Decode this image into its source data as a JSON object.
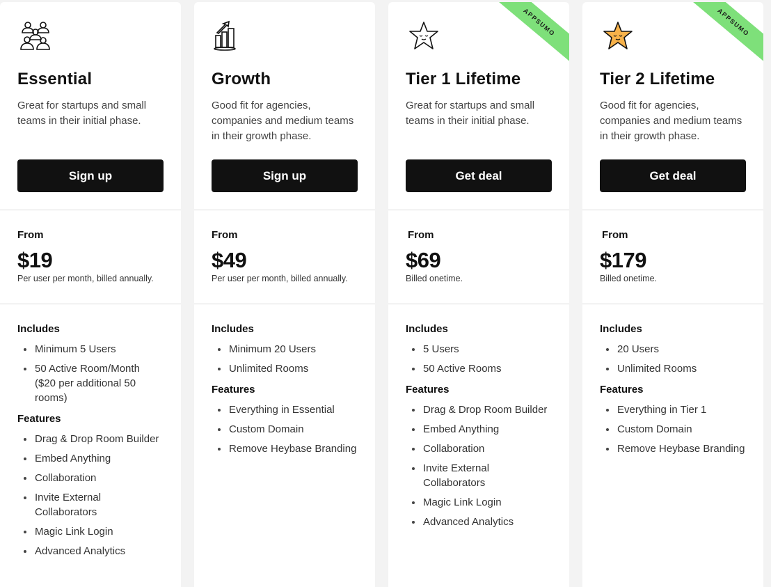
{
  "plans": [
    {
      "name": "Essential",
      "icon": "team-people-icon",
      "description": "Great for startups and small teams in their initial phase.",
      "cta": "Sign up",
      "price_prefix": "From",
      "price": "$19",
      "billing": "Per user per month, billed annually.",
      "includes_heading": "Includes",
      "includes": [
        "Minimum 5 Users",
        "50 Active Room/Month ($20 per additional 50 rooms)"
      ],
      "features_heading": "Features",
      "features": [
        "Drag & Drop Room Builder",
        "Embed Anything",
        "Collaboration",
        "Invite External Collaborators",
        "Magic Link Login",
        "Advanced Analytics"
      ]
    },
    {
      "name": "Growth",
      "icon": "growth-chart-icon",
      "description": "Good fit for agencies, companies and medium teams in their growth phase.",
      "cta": "Sign up",
      "price_prefix": "From",
      "price": "$49",
      "billing": "Per user per month, billed annually.",
      "includes_heading": "Includes",
      "includes": [
        "Minimum 20 Users",
        "Unlimited Rooms"
      ],
      "features_heading": "Features",
      "features": [
        "Everything in Essential",
        "Custom Domain",
        "Remove Heybase Branding"
      ]
    },
    {
      "name": "Tier 1 Lifetime",
      "icon": "star-outline-icon",
      "badge": "APPSUMO",
      "description": "Great for startups and small teams in their initial phase.",
      "cta": "Get deal",
      "price_prefix": "From",
      "price": "$69",
      "billing": "Billed onetime.",
      "includes_heading": "Includes",
      "includes": [
        "5 Users",
        "50 Active Rooms"
      ],
      "features_heading": "Features",
      "features": [
        "Drag & Drop Room Builder",
        "Embed Anything",
        "Collaboration",
        "Invite External Collaborators",
        "Magic Link Login",
        "Advanced Analytics"
      ]
    },
    {
      "name": "Tier 2 Lifetime",
      "icon": "star-filled-icon",
      "badge": "APPSUMO",
      "description": "Good fit for agencies, companies and medium teams in their growth phase.",
      "cta": "Get deal",
      "price_prefix": "From",
      "price": "$179",
      "billing": "Billed onetime.",
      "includes_heading": "Includes",
      "includes": [
        "20 Users",
        "Unlimited Rooms"
      ],
      "features_heading": "Features",
      "features": [
        "Everything in Tier 1",
        "Custom Domain",
        "Remove Heybase Branding"
      ]
    }
  ],
  "colors": {
    "button_bg": "#111111",
    "badge_bg": "#7ee07a",
    "star_fill": "#f7b24a",
    "page_bg": "#f3f3f3"
  }
}
